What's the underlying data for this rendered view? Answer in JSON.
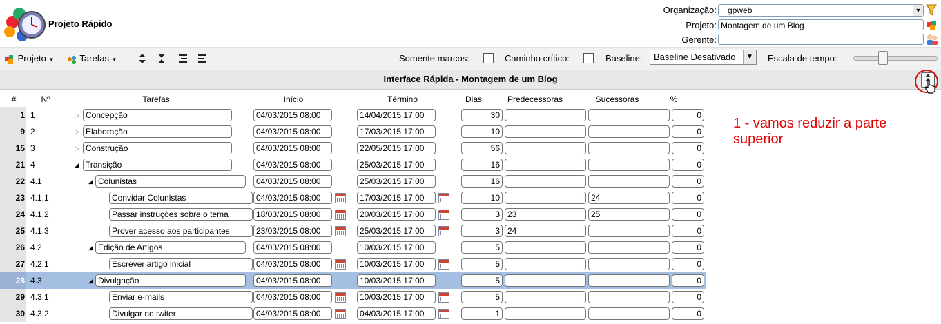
{
  "app": {
    "title": "Projeto Rápido"
  },
  "header": {
    "org_label": "Organização:",
    "org_value": "gpweb",
    "project_label": "Projeto:",
    "project_value": "Montagem de um Blog",
    "manager_label": "Gerente:",
    "manager_value": ""
  },
  "toolbar": {
    "project_menu": "Projeto",
    "tasks_menu": "Tarefas",
    "milestones_label": "Somente marcos:",
    "critical_label": "Caminho crítico:",
    "baseline_label": "Baseline:",
    "baseline_value": "Baseline Desativado",
    "timescale_label": "Escala de tempo:",
    "timescale_level": 0.33
  },
  "section": {
    "title": "Interface Rápida - Montagem de um Blog"
  },
  "columns": {
    "idx": "#",
    "no": "Nº",
    "task": "Tarefas",
    "start": "Início",
    "end": "Término",
    "days": "Dias",
    "pred": "Predecessoras",
    "succ": "Sucessoras",
    "pct": "%"
  },
  "rows": [
    {
      "idx": "1",
      "no": "1",
      "name": "Concepção",
      "start": "04/03/2015 08:00",
      "end": "14/04/2015 17:00",
      "days": "30",
      "pred": "",
      "succ": "",
      "pct": "0",
      "level": 0,
      "toggle": "closed"
    },
    {
      "idx": "9",
      "no": "2",
      "name": "Elaboração",
      "start": "04/03/2015 08:00",
      "end": "17/03/2015 17:00",
      "days": "10",
      "pred": "",
      "succ": "",
      "pct": "0",
      "level": 0,
      "toggle": "closed"
    },
    {
      "idx": "15",
      "no": "3",
      "name": "Construção",
      "start": "04/03/2015 08:00",
      "end": "22/05/2015 17:00",
      "days": "56",
      "pred": "",
      "succ": "",
      "pct": "0",
      "level": 0,
      "toggle": "closed"
    },
    {
      "idx": "21",
      "no": "4",
      "name": "Transição",
      "start": "04/03/2015 08:00",
      "end": "25/03/2015 17:00",
      "days": "16",
      "pred": "",
      "succ": "",
      "pct": "0",
      "level": 0,
      "toggle": "open"
    },
    {
      "idx": "22",
      "no": "4.1",
      "name": "Colunistas",
      "start": "04/03/2015 08:00",
      "end": "25/03/2015 17:00",
      "days": "16",
      "pred": "",
      "succ": "",
      "pct": "0",
      "level": 1,
      "toggle": "open"
    },
    {
      "idx": "23",
      "no": "4.1.1",
      "name": "Convidar Colunistas",
      "start": "04/03/2015 08:00",
      "end": "17/03/2015 17:00",
      "days": "10",
      "pred": "",
      "succ": "24",
      "pct": "0",
      "level": 2,
      "toggle": "none"
    },
    {
      "idx": "24",
      "no": "4.1.2",
      "name": "Passar instruções sobre o  tema",
      "start": "18/03/2015 08:00",
      "end": "20/03/2015 17:00",
      "days": "3",
      "pred": "23",
      "succ": "25",
      "pct": "0",
      "level": 2,
      "toggle": "none"
    },
    {
      "idx": "25",
      "no": "4.1.3",
      "name": "Prover acesso aos participantes",
      "start": "23/03/2015 08:00",
      "end": "25/03/2015 17:00",
      "days": "3",
      "pred": "24",
      "succ": "",
      "pct": "0",
      "level": 2,
      "toggle": "none"
    },
    {
      "idx": "26",
      "no": "4.2",
      "name": "Edição de Artigos",
      "start": "04/03/2015 08:00",
      "end": "10/03/2015 17:00",
      "days": "5",
      "pred": "",
      "succ": "",
      "pct": "0",
      "level": 1,
      "toggle": "open"
    },
    {
      "idx": "27",
      "no": "4.2.1",
      "name": "Escrever artigo inicial",
      "start": "04/03/2015 08:00",
      "end": "10/03/2015 17:00",
      "days": "5",
      "pred": "",
      "succ": "",
      "pct": "0",
      "level": 2,
      "toggle": "none"
    },
    {
      "idx": "28",
      "no": "4.3",
      "name": "Divulgação",
      "start": "04/03/2015 08:00",
      "end": "10/03/2015 17:00",
      "days": "5",
      "pred": "",
      "succ": "",
      "pct": "0",
      "level": 1,
      "toggle": "open",
      "selected": true
    },
    {
      "idx": "29",
      "no": "4.3.1",
      "name": "Enviar e-mails",
      "start": "04/03/2015 08:00",
      "end": "10/03/2015 17:00",
      "days": "5",
      "pred": "",
      "succ": "",
      "pct": "0",
      "level": 2,
      "toggle": "none"
    },
    {
      "idx": "30",
      "no": "4.3.2",
      "name": "Divulgar no twiter",
      "start": "04/03/2015 08:00",
      "end": "04/03/2015 17:00",
      "days": "1",
      "pred": "",
      "succ": "",
      "pct": "0",
      "level": 2,
      "toggle": "none"
    }
  ],
  "annotation": "1 - vamos reduzir a parte superior",
  "colors": {
    "selected_row": "#a5bfe2",
    "annotation": "#e00000"
  }
}
